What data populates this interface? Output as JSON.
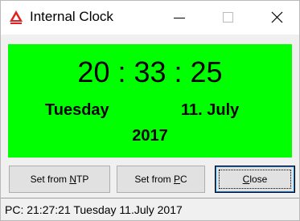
{
  "window": {
    "title": "Internal Clock",
    "app_icon": "red-triangle-logo-icon"
  },
  "titlebar_buttons": {
    "minimize_icon": "minimize-icon",
    "maximize_icon": "maximize-icon",
    "close_icon": "close-icon"
  },
  "clock": {
    "time": "20 : 33 : 25",
    "day": "Tuesday",
    "date": "11. July",
    "year": "2017",
    "background_color": "#00ff00"
  },
  "buttons": {
    "ntp_prefix": "Set from ",
    "ntp_mnemonic": "N",
    "ntp_suffix": "TP",
    "pc_prefix": "Set from ",
    "pc_mnemonic": "P",
    "pc_suffix": "C",
    "close_mnemonic": "C",
    "close_suffix": "lose"
  },
  "status": {
    "text": "PC:  21:27:21  Tuesday  11.July  2017"
  }
}
